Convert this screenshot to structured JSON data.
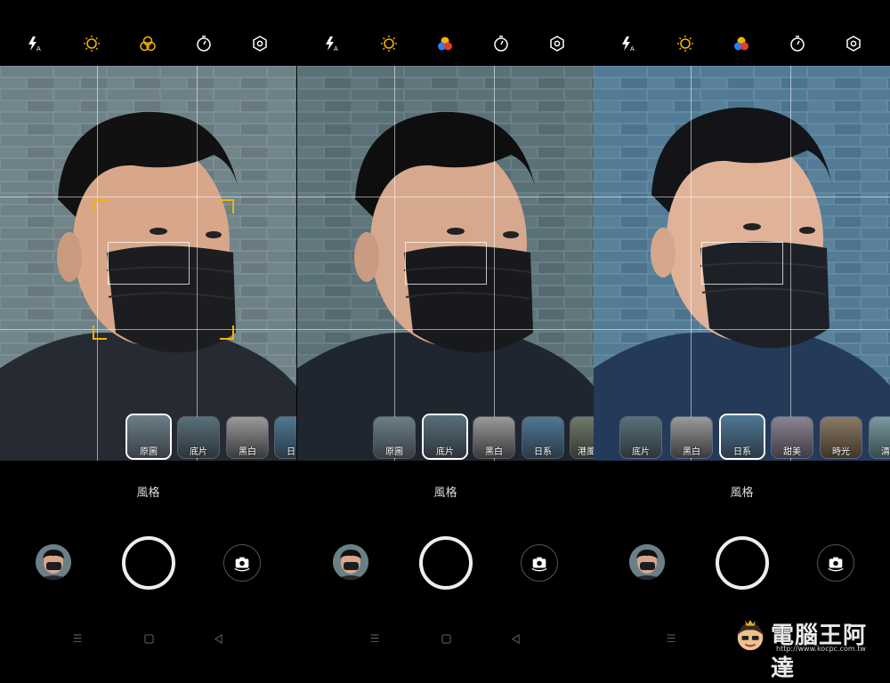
{
  "panels": [
    {
      "mode_label": "風格",
      "filters": [
        {
          "label": "原圖",
          "active": true
        },
        {
          "label": "底片",
          "active": false
        },
        {
          "label": "黑白",
          "active": false
        },
        {
          "label": "日系",
          "active": false
        }
      ],
      "tint": "#6b7f86"
    },
    {
      "mode_label": "風格",
      "filters": [
        {
          "label": "原圖",
          "active": false
        },
        {
          "label": "底片",
          "active": true
        },
        {
          "label": "黑白",
          "active": false
        },
        {
          "label": "日系",
          "active": false
        },
        {
          "label": "港風圖",
          "active": false
        }
      ],
      "tint": "#587079"
    },
    {
      "mode_label": "風格",
      "filters": [
        {
          "label": "底片",
          "active": false
        },
        {
          "label": "黑白",
          "active": false
        },
        {
          "label": "日系",
          "active": true
        },
        {
          "label": "甜美",
          "active": false
        },
        {
          "label": "時光",
          "active": false
        },
        {
          "label": "清新",
          "active": false
        }
      ],
      "tint": "#4f7893"
    }
  ],
  "icons": {
    "flash": "flash-auto-icon",
    "sun": "brightness-icon",
    "filter": "color-filter-icon",
    "timer": "timer-icon",
    "settings": "settings-icon"
  },
  "colors": {
    "accent": "#f2b400",
    "shutter": "#eeeeee"
  },
  "watermark": {
    "text": "電腦王阿達",
    "url": "http://www.kocpc.com.tw"
  }
}
